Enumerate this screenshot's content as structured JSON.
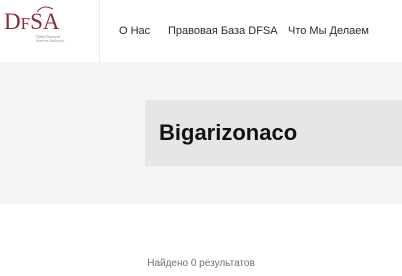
{
  "logo": {
    "letter_d": "D",
    "letter_f": "F",
    "letter_s": "S",
    "letter_a": "A",
    "subtitle_line1": "Dubai Financial",
    "subtitle_line2": "Services Authority"
  },
  "nav": {
    "items": [
      "О Нас",
      "Правовая База DFSA",
      "Что Мы Делаем"
    ]
  },
  "banner": {
    "title": "Bigarizonaco"
  },
  "results": {
    "text": "Найдено 0 результатов"
  },
  "colors": {
    "brand": "#8c2a38",
    "banner_bg": "#f4f4f4",
    "title_box_bg": "#e6e6e6"
  }
}
